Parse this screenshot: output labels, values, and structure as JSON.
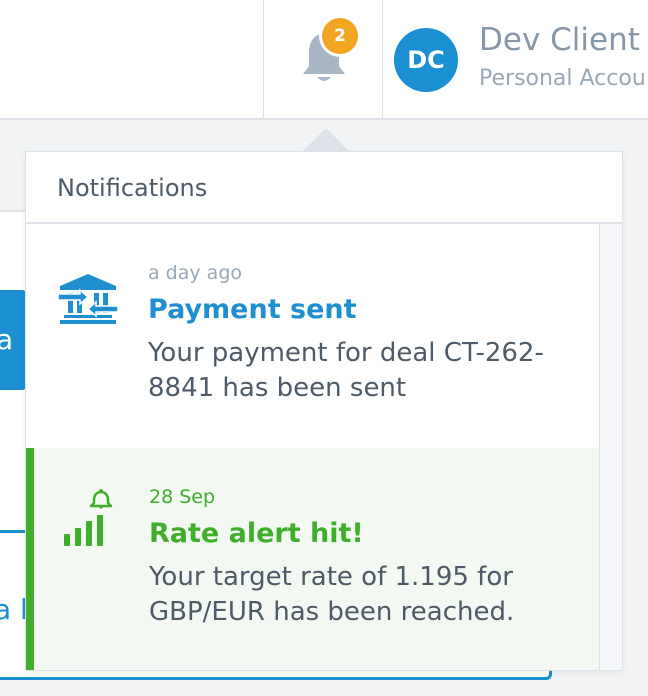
{
  "header": {
    "notification_count": "2",
    "user_initials": "DC",
    "user_name": "Dev Client",
    "user_account": "Personal Accou"
  },
  "background": {
    "card1_fragment": "a F",
    "card2_fragment": "a l"
  },
  "notifications": {
    "title": "Notifications",
    "items": [
      {
        "time": "a day ago",
        "title": "Payment sent",
        "body": "Your payment for deal CT-262-8841 has been sent",
        "icon": "bank-transfer-icon",
        "color": "#1f8fcf"
      },
      {
        "time": "28 Sep",
        "title": "Rate alert hit!",
        "body": "Your target rate of 1.195 for GBP/EUR has been reached.",
        "icon": "rate-alert-icon",
        "color": "#3fae2a",
        "highlighted": true
      }
    ]
  },
  "colors": {
    "brand_blue": "#1a8fd1",
    "badge_orange": "#f2a623",
    "success_green": "#3fae2a"
  }
}
